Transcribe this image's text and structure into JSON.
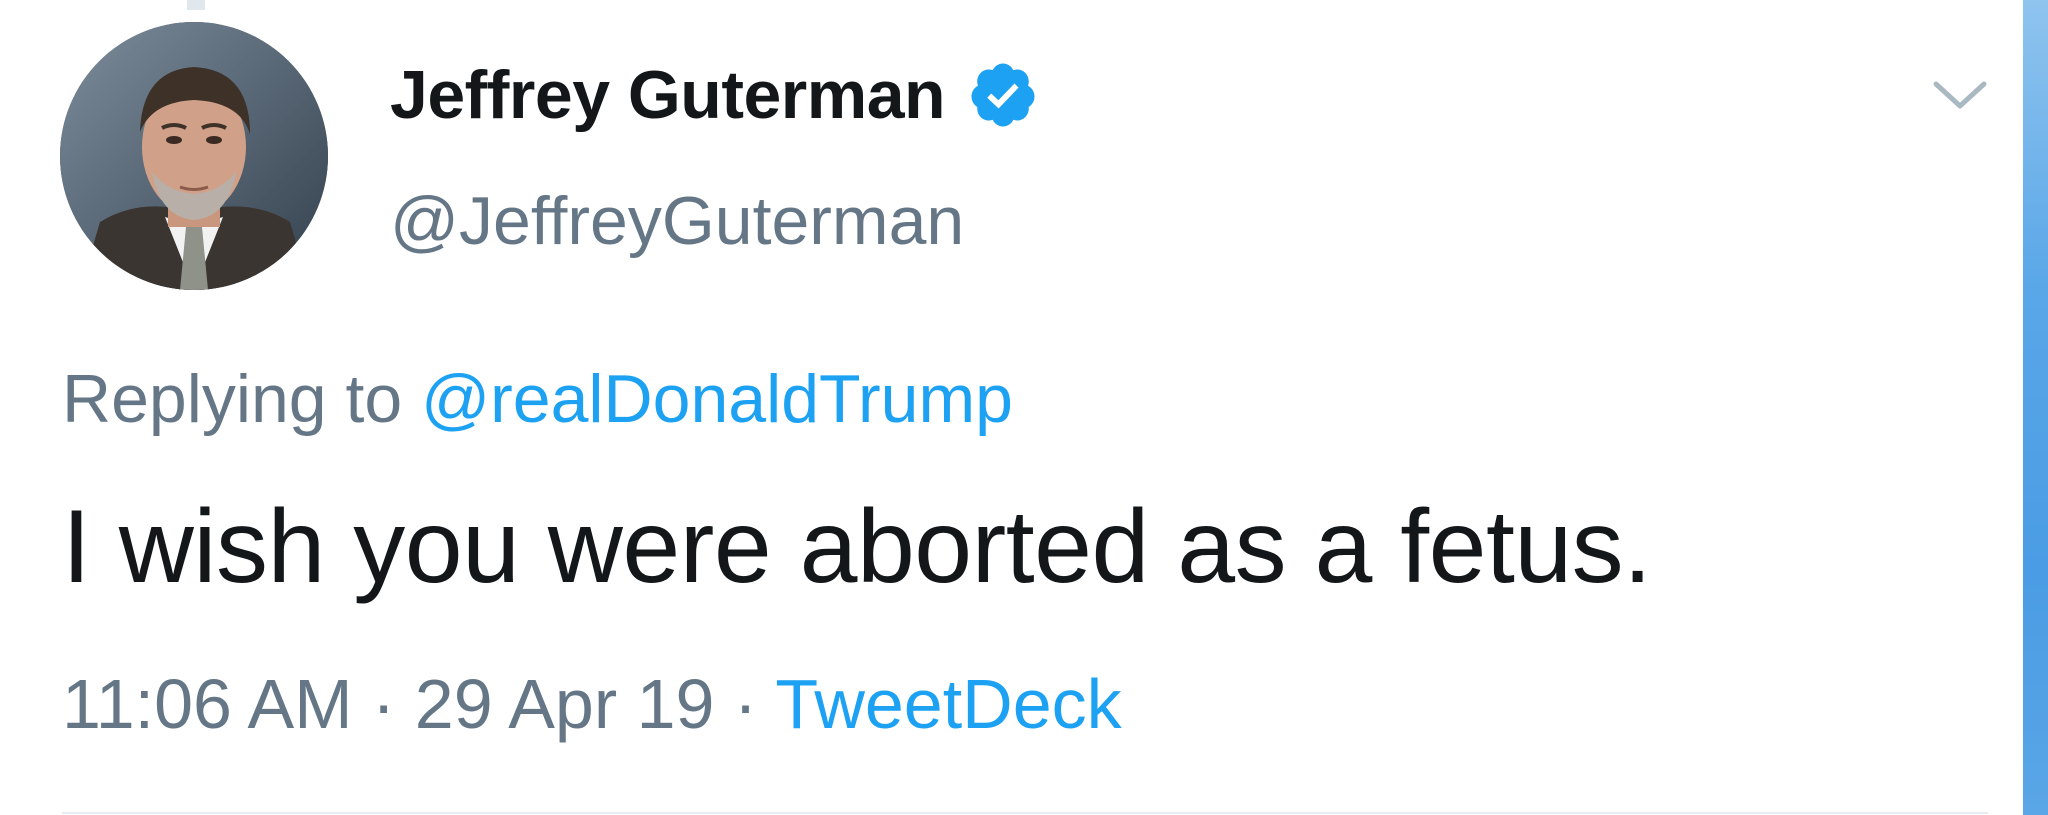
{
  "tweet": {
    "author": {
      "display_name": "Jeffrey Guterman",
      "handle": "@JeffreyGuterman",
      "verified": true,
      "avatar_icon": "avatar-photo"
    },
    "reply": {
      "prefix": "Replying to",
      "handle": "@realDonaldTrump"
    },
    "text": "I wish you were aborted as a fetus.",
    "meta": {
      "time": "11:06 AM",
      "separator": "·",
      "date": "29 Apr 19",
      "source": "TweetDeck"
    },
    "menu_icon": "chevron-down-icon"
  },
  "colors": {
    "text_primary": "#14171a",
    "text_secondary": "#657786",
    "link_blue": "#1da1f2",
    "divider": "#e6ecf0",
    "side_strip": "#4a9ce4"
  }
}
